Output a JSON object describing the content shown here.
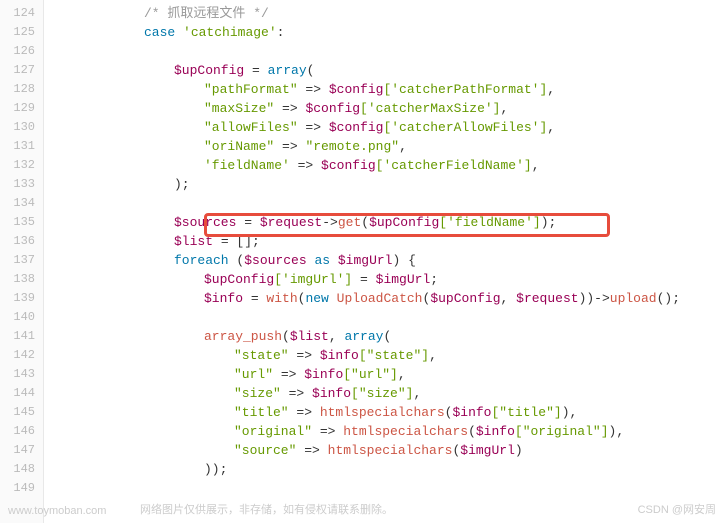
{
  "lineNumbers": [
    "124",
    "125",
    "126",
    "127",
    "128",
    "129",
    "130",
    "131",
    "132",
    "133",
    "134",
    "135",
    "136",
    "137",
    "138",
    "139",
    "140",
    "141",
    "142",
    "143",
    "144",
    "145",
    "146",
    "147",
    "148",
    "149"
  ],
  "l124_comment": "/* 抓取远程文件 */",
  "l125_case": "case",
  "l125_str": "'catchimage'",
  "l125_colon": ":",
  "l127_var": "$upConfig",
  "l127_eq": " = ",
  "l127_array": "array",
  "l127_paren": "(",
  "l128_key": "\"pathFormat\"",
  "l128_arrow": " => ",
  "l128_cfg": "$config",
  "l128_idx": "['catcherPathFormat']",
  "l128_comma": ",",
  "l129_key": "\"maxSize\"",
  "l129_arrow": " => ",
  "l129_cfg": "$config",
  "l129_idx": "['catcherMaxSize']",
  "l129_comma": ",",
  "l130_key": "\"allowFiles\"",
  "l130_arrow": " => ",
  "l130_cfg": "$config",
  "l130_idx": "['catcherAllowFiles']",
  "l130_comma": ",",
  "l131_key": "\"oriName\"",
  "l131_arrow": " => ",
  "l131_val": "\"remote.png\"",
  "l131_comma": ",",
  "l132_key": "'fieldName'",
  "l132_arrow": " => ",
  "l132_cfg": "$config",
  "l132_idx": "['catcherFieldName']",
  "l132_comma": ",",
  "l133_close": ");",
  "l135_var": "$sources",
  "l135_eq": " = ",
  "l135_req": "$request",
  "l135_arrow": "->",
  "l135_get": "get",
  "l135_p1": "(",
  "l135_up": "$upConfig",
  "l135_idx": "['fieldName']",
  "l135_p2": ");",
  "l136_var": "$list",
  "l136_eq": " = [];",
  "l137_foreach": "foreach",
  "l137_p1": " (",
  "l137_src": "$sources",
  "l137_as": " as ",
  "l137_img": "$imgUrl",
  "l137_p2": ") {",
  "l138_up": "$upConfig",
  "l138_idx": "['imgUrl']",
  "l138_eq": " = ",
  "l138_img": "$imgUrl",
  "l138_semi": ";",
  "l139_info": "$info",
  "l139_eq": " = ",
  "l139_with": "with",
  "l139_p1": "(",
  "l139_new": "new",
  "l139_sp": " ",
  "l139_cls": "UploadCatch",
  "l139_p2": "(",
  "l139_up": "$upConfig",
  "l139_comma": ", ",
  "l139_req": "$request",
  "l139_p3": "))->",
  "l139_upload": "upload",
  "l139_p4": "();",
  "l141_push": "array_push",
  "l141_p1": "(",
  "l141_list": "$list",
  "l141_comma": ", ",
  "l141_array": "array",
  "l141_p2": "(",
  "l142_key": "\"state\"",
  "l142_arrow": " => ",
  "l142_info": "$info",
  "l142_idx": "[\"state\"]",
  "l142_comma": ",",
  "l143_key": "\"url\"",
  "l143_arrow": " => ",
  "l143_info": "$info",
  "l143_idx": "[\"url\"]",
  "l143_comma": ",",
  "l144_key": "\"size\"",
  "l144_arrow": " => ",
  "l144_info": "$info",
  "l144_idx": "[\"size\"]",
  "l144_comma": ",",
  "l145_key": "\"title\"",
  "l145_arrow": " => ",
  "l145_func": "htmlspecialchars",
  "l145_p1": "(",
  "l145_info": "$info",
  "l145_idx": "[\"title\"]",
  "l145_p2": "),",
  "l146_key": "\"original\"",
  "l146_arrow": " => ",
  "l146_func": "htmlspecialchars",
  "l146_p1": "(",
  "l146_info": "$info",
  "l146_idx": "[\"original\"]",
  "l146_p2": "),",
  "l147_key": "\"source\"",
  "l147_arrow": " => ",
  "l147_func": "htmlspecialchars",
  "l147_p1": "(",
  "l147_img": "$imgUrl",
  "l147_p2": ")",
  "l148_close": "));",
  "watermark_left": "www.toymoban.com",
  "watermark_mid": "网络图片仅供展示，非存储，如有侵权请联系删除。",
  "watermark_right": "CSDN @网安周"
}
